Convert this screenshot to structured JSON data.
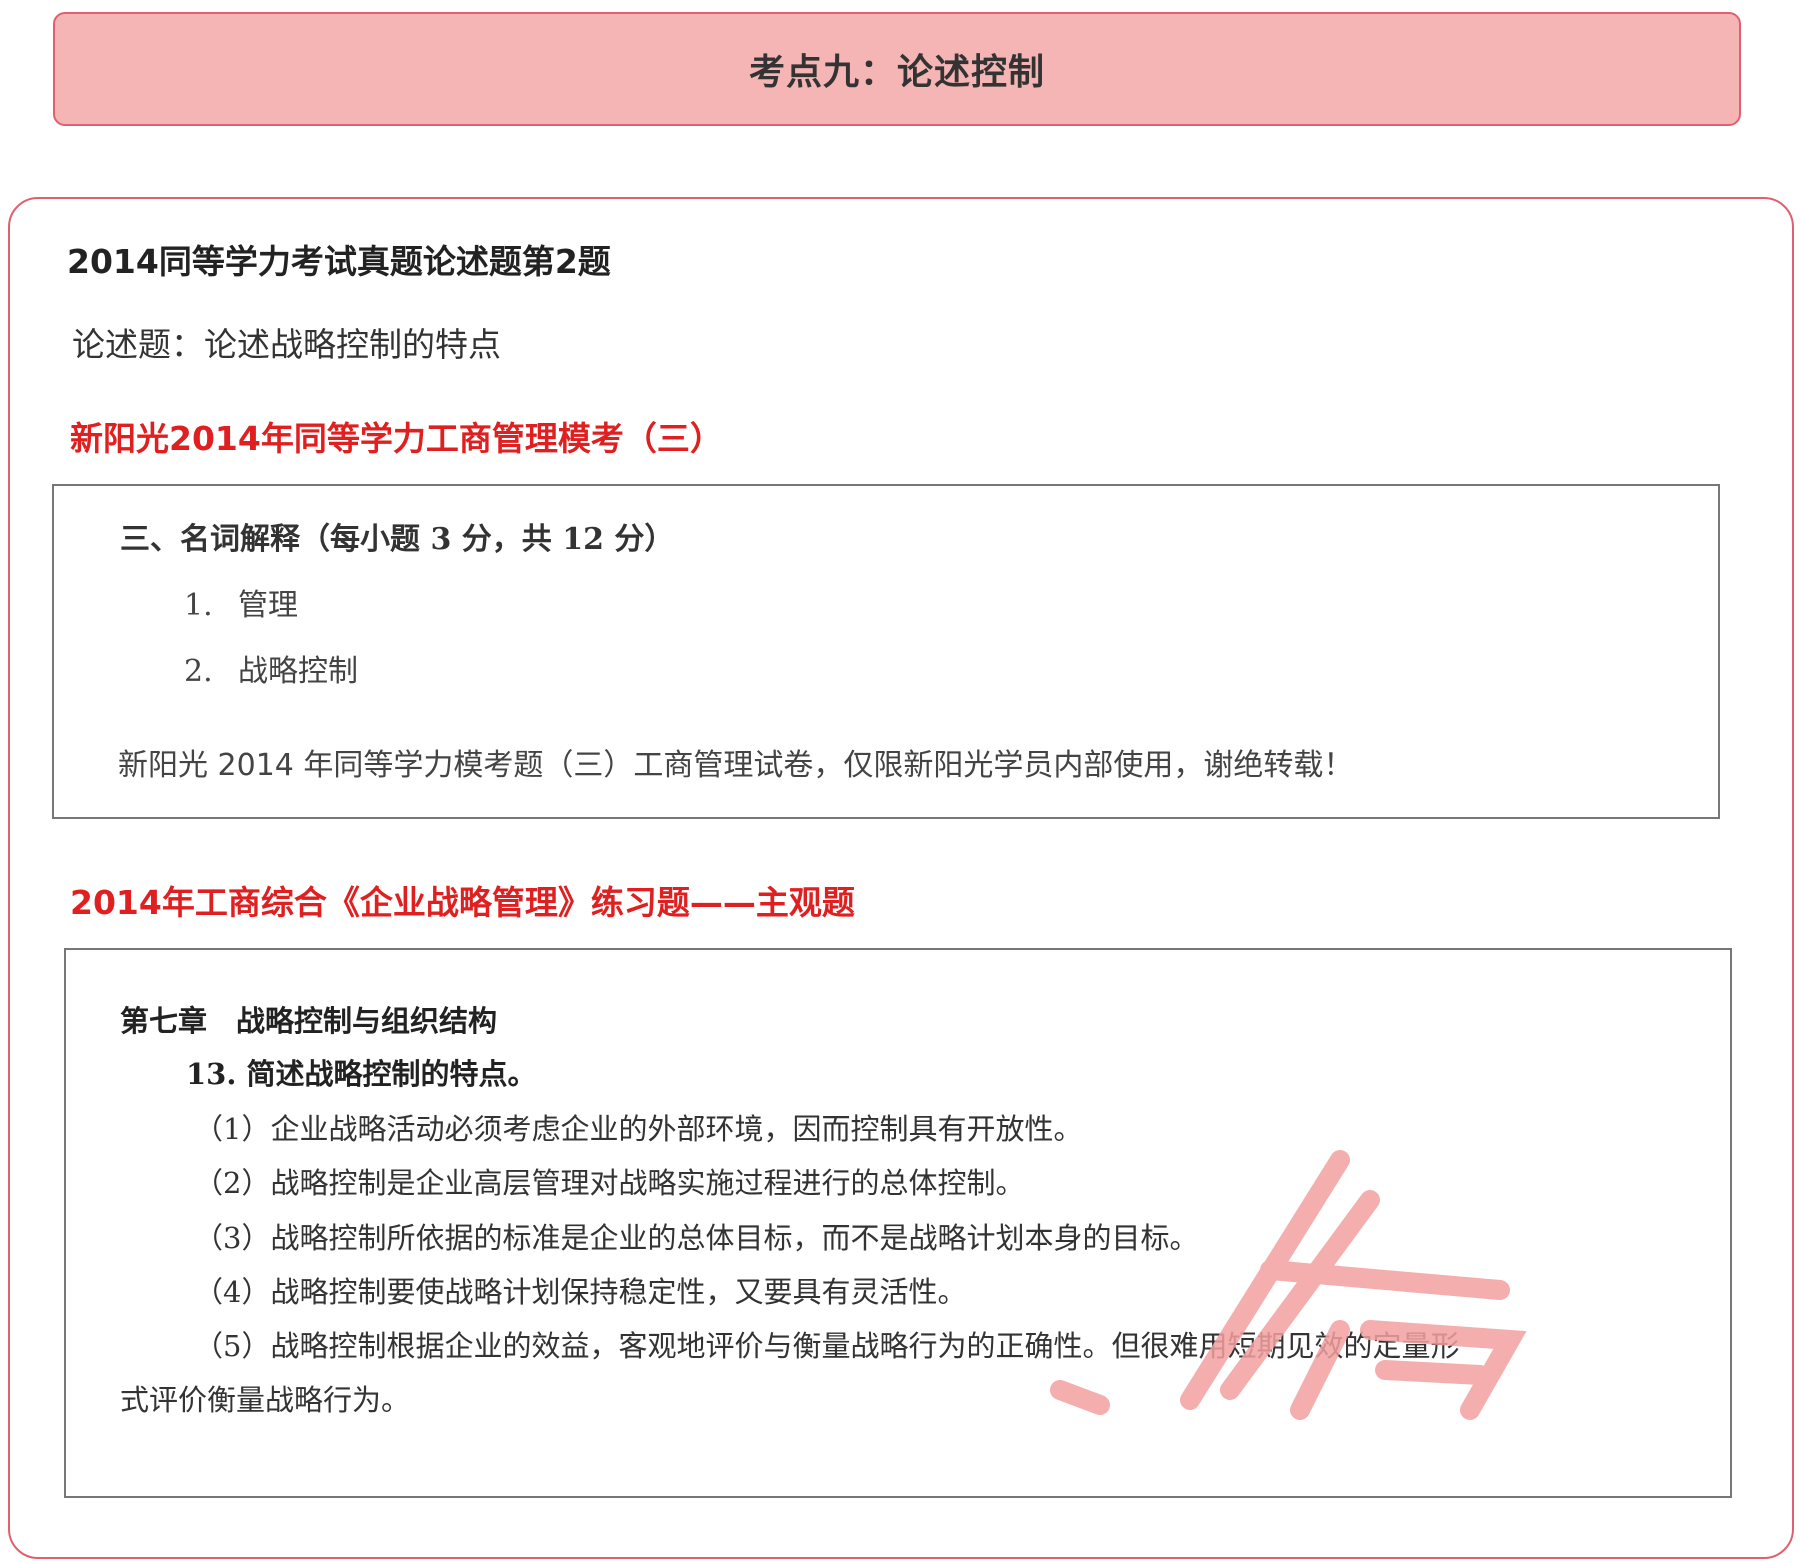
{
  "banner": {
    "title": "考点九：论述控制"
  },
  "exam_question": {
    "title": "2014同等学力考试真题论述题第2题",
    "text": "论述题：论述战略控制的特点"
  },
  "mock_exam": {
    "heading": "新阳光2014年同等学力工商管理模考（三）",
    "section_heading": "三、名词解释（每小题 3 分，共 12 分）",
    "items": [
      {
        "num": "1.",
        "text": "管理"
      },
      {
        "num": "2.",
        "text": "战略控制"
      }
    ],
    "footer": "新阳光 2014 年同等学力模考题（三）工商管理试卷，仅限新阳光学员内部使用，谢绝转载！"
  },
  "exercise": {
    "heading": "2014年工商综合《企业战略管理》练习题——主观题",
    "chapter": "第七章　战略控制与组织结构",
    "question": "13. 简述战略控制的特点。",
    "points": [
      "（1）企业战略活动必须考虑企业的外部环境，因而控制具有开放性。",
      "（2）战略控制是企业高层管理对战略实施过程进行的总体控制。",
      "（3）战略控制所依据的标准是企业的总体目标，而不是战略计划本身的目标。",
      "（4）战略控制要使战略计划保持稳定性，又要具有灵活性。",
      "（5）战略控制根据企业的效益，客观地评价与衡量战略行为的正确性。但很难用短期见效的定量形",
      "式评价衡量战略行为。"
    ]
  },
  "colors": {
    "banner_bg": "#f5b5b5",
    "accent_border": "#e0606e",
    "red_heading": "#e02020",
    "watermark": "#f3a0a0"
  }
}
